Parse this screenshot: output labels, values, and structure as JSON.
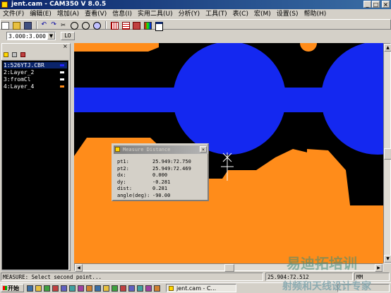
{
  "window": {
    "title": "jent.cam - CAM350 V 8.0.5",
    "controls": [
      "_",
      "□",
      "×"
    ]
  },
  "menu": [
    "文件(F)",
    "编辑(E)",
    "增加(A)",
    "查看(V)",
    "信息(I)",
    "实用二具(U)",
    "分析(Y)",
    "工具(T)",
    "表(C)",
    "宏(M)",
    "设置(S)",
    "帮助(H)"
  ],
  "toolbar": {
    "icons": [
      "new-file-icon",
      "open-folder-icon",
      "save-icon",
      "undo-icon",
      "redo-icon",
      "cut-icon",
      "zoom-in-icon",
      "zoom-out-icon",
      "zoom-fit-icon",
      "grid-icon",
      "layer-icon",
      "snap-icon",
      "color-icon",
      "window-icon"
    ]
  },
  "grid": {
    "value": "3.000:3.000",
    "layer_button": "L0"
  },
  "layers_panel": {
    "close": "×",
    "items": [
      {
        "label": "1:526YTJ.CBR",
        "color": "#2222ff",
        "selected": true
      },
      {
        "label": "2:Layer_2",
        "color": "#ffffff",
        "selected": false
      },
      {
        "label": "3:fromCl",
        "color": "#ffffff",
        "selected": false
      },
      {
        "label": "4:Layer_4",
        "color": "#ff8c1a",
        "selected": false
      }
    ]
  },
  "canvas": {
    "background": "#000000",
    "copper_blue": "#1428f0",
    "copper_orange": "#ff8c1a"
  },
  "dialog": {
    "title": "Measure Distance",
    "close": "×",
    "rows": [
      {
        "label": "pt1:",
        "value": "25.949:72.750"
      },
      {
        "label": "pt2:",
        "value": "25.949:72.469"
      },
      {
        "label": "dx:",
        "value": "0.000"
      },
      {
        "label": "dy:",
        "value": "-0.281"
      },
      {
        "label": "dist:",
        "value": "0.281"
      },
      {
        "label": "angle(deg):",
        "value": "-90.00"
      }
    ]
  },
  "status": {
    "message": "MEASURE: Select second point...",
    "coords": "25.904:72.512",
    "units": "MM"
  },
  "taskbar": {
    "start": "开始",
    "active_task": "jent.cam - C..."
  },
  "watermark": {
    "line1": "易迪拓培训",
    "line2": "射频和天线设计专家"
  }
}
